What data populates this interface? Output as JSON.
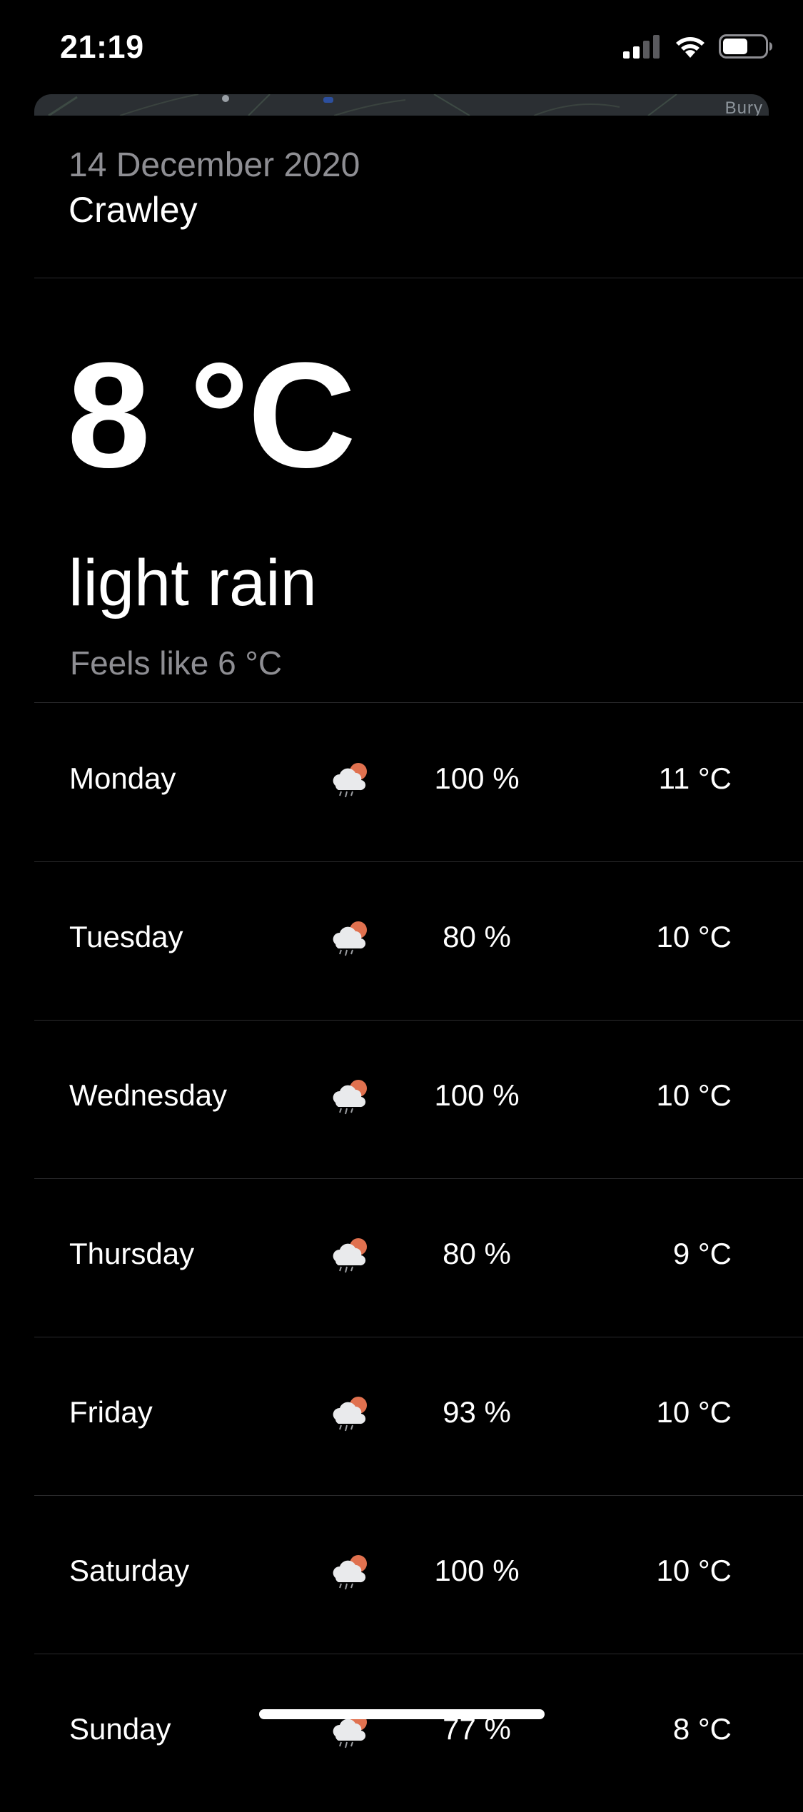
{
  "status_bar": {
    "time": "21:19",
    "icons": [
      "cellular-signal-icon",
      "wifi-icon",
      "battery-icon"
    ]
  },
  "map": {
    "label": "Bury"
  },
  "header": {
    "date": "14 December 2020",
    "city": "Crawley"
  },
  "current": {
    "temperature": "8 °C",
    "condition": "light rain",
    "feels_like": "Feels like 6 °C"
  },
  "forecast": [
    {
      "day": "Monday",
      "icon": "cloud-sun-rain-icon",
      "precip": "100 %",
      "high": "11 °C"
    },
    {
      "day": "Tuesday",
      "icon": "cloud-sun-rain-icon",
      "precip": "80 %",
      "high": "10 °C"
    },
    {
      "day": "Wednesday",
      "icon": "cloud-sun-rain-icon",
      "precip": "100 %",
      "high": "10 °C"
    },
    {
      "day": "Thursday",
      "icon": "cloud-sun-rain-icon",
      "precip": "80 %",
      "high": "9 °C"
    },
    {
      "day": "Friday",
      "icon": "cloud-sun-rain-icon",
      "precip": "93 %",
      "high": "10 °C"
    },
    {
      "day": "Saturday",
      "icon": "cloud-sun-rain-icon",
      "precip": "100 %",
      "high": "10 °C"
    },
    {
      "day": "Sunday",
      "icon": "cloud-sun-rain-icon",
      "precip": "77 %",
      "high": "8 °C"
    }
  ],
  "colors": {
    "background": "#000000",
    "text": "#ffffff",
    "secondary_text": "#8e8e93",
    "sun_accent": "#e0714f"
  }
}
